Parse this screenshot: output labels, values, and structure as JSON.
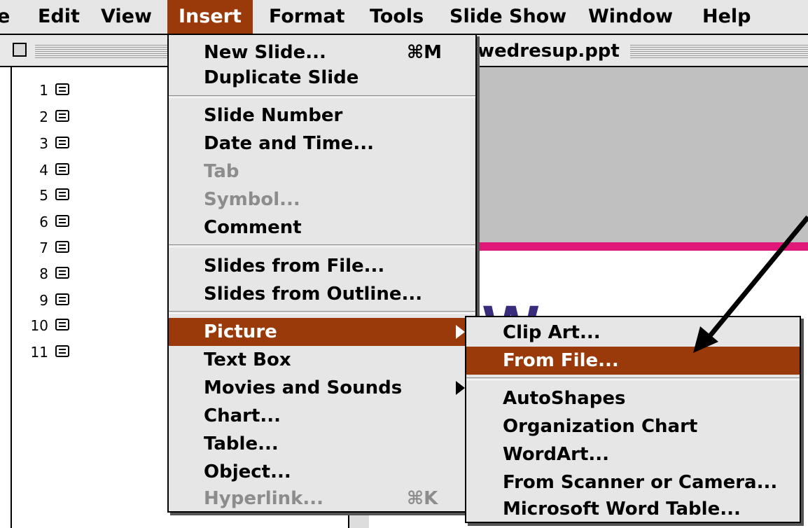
{
  "menubar": {
    "items": [
      "e",
      "Edit",
      "View",
      "Insert",
      "Format",
      "Tools",
      "Slide Show",
      "Window",
      "Help"
    ],
    "active": "Insert"
  },
  "window": {
    "title": "wedresup.ppt"
  },
  "outline": {
    "slides": [
      "1",
      "2",
      "3",
      "4",
      "5",
      "6",
      "7",
      "8",
      "9",
      "10",
      "11"
    ]
  },
  "slide": {
    "title_partial": "W",
    "stripe_color": "#e0187a",
    "title_color": "#3a2c7c"
  },
  "insert_menu": {
    "items": [
      {
        "label": "New Slide...",
        "shortcut": "⌘M",
        "enabled": true
      },
      {
        "label": "Duplicate Slide",
        "enabled": true
      },
      {
        "label": "Slide Number",
        "enabled": true
      },
      {
        "label": "Date and Time...",
        "enabled": true
      },
      {
        "label": "Tab",
        "enabled": false
      },
      {
        "label": "Symbol...",
        "enabled": false
      },
      {
        "label": "Comment",
        "enabled": true
      },
      {
        "label": "Slides from File...",
        "enabled": true
      },
      {
        "label": "Slides from Outline...",
        "enabled": true
      },
      {
        "label": "Picture",
        "enabled": true,
        "submenu": true,
        "highlighted": true
      },
      {
        "label": "Text Box",
        "enabled": true
      },
      {
        "label": "Movies and Sounds",
        "enabled": true,
        "submenu": true
      },
      {
        "label": "Chart...",
        "enabled": true
      },
      {
        "label": "Table...",
        "enabled": true
      },
      {
        "label": "Object...",
        "enabled": true
      },
      {
        "label": "Hyperlink...",
        "shortcut": "⌘K",
        "enabled": false
      }
    ]
  },
  "picture_submenu": {
    "items": [
      {
        "label": "Clip Art..."
      },
      {
        "label": "From File...",
        "highlighted": true
      },
      {
        "label": "AutoShapes"
      },
      {
        "label": "Organization Chart"
      },
      {
        "label": "WordArt..."
      },
      {
        "label": "From Scanner or Camera..."
      },
      {
        "label": "Microsoft Word Table..."
      }
    ]
  },
  "colors": {
    "menu_highlight": "#9a3a0a",
    "menu_background": "#e6e6e6",
    "disabled_text": "#8c8c8c"
  }
}
